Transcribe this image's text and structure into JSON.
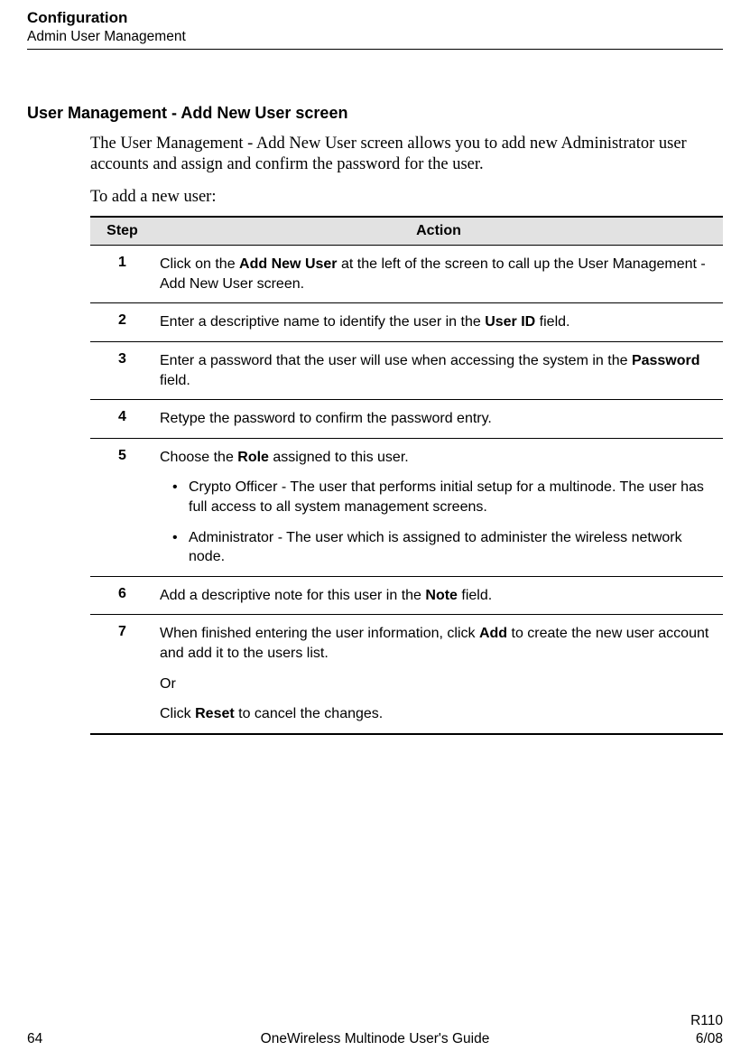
{
  "header": {
    "title": "Configuration",
    "subtitle": "Admin User Management"
  },
  "section_heading": "User Management - Add New User screen",
  "intro_text": "The User Management - Add New User screen allows you to add new Administrator user accounts and assign and confirm the password for the user.",
  "lead_text": "To add a new user:",
  "table": {
    "headers": {
      "step": "Step",
      "action": "Action"
    },
    "rows": [
      {
        "num": "1",
        "html": "Click on the <b>Add New User</b> at the left of the screen to call up the User Management - Add New User screen."
      },
      {
        "num": "2",
        "html": "Enter a descriptive name to identify the user in the <b>User ID</b> field."
      },
      {
        "num": "3",
        "html": "Enter a password that the user will use when accessing the system in the <b>Password</b> field."
      },
      {
        "num": "4",
        "html": "Retype the password to confirm the password entry."
      },
      {
        "num": "5",
        "html": "<p>Choose the <b>Role</b> assigned to this user.</p><ul><li>Crypto Officer - The user that performs initial setup for a multinode.  The user has full access to all system management screens.</li><li>Administrator - The user which is assigned to administer the wireless network node.</li></ul>"
      },
      {
        "num": "6",
        "html": "Add a descriptive note for this user in the <b>Note</b> field."
      },
      {
        "num": "7",
        "html": "<p>When finished entering the user information, click <b>Add</b> to create the new user account and add it to the users list.</p><p>Or</p><p>Click <b>Reset</b> to cancel the changes.</p>"
      }
    ]
  },
  "footer": {
    "page": "64",
    "center": "OneWireless Multinode User's Guide",
    "right1": "R110",
    "right2": "6/08"
  }
}
